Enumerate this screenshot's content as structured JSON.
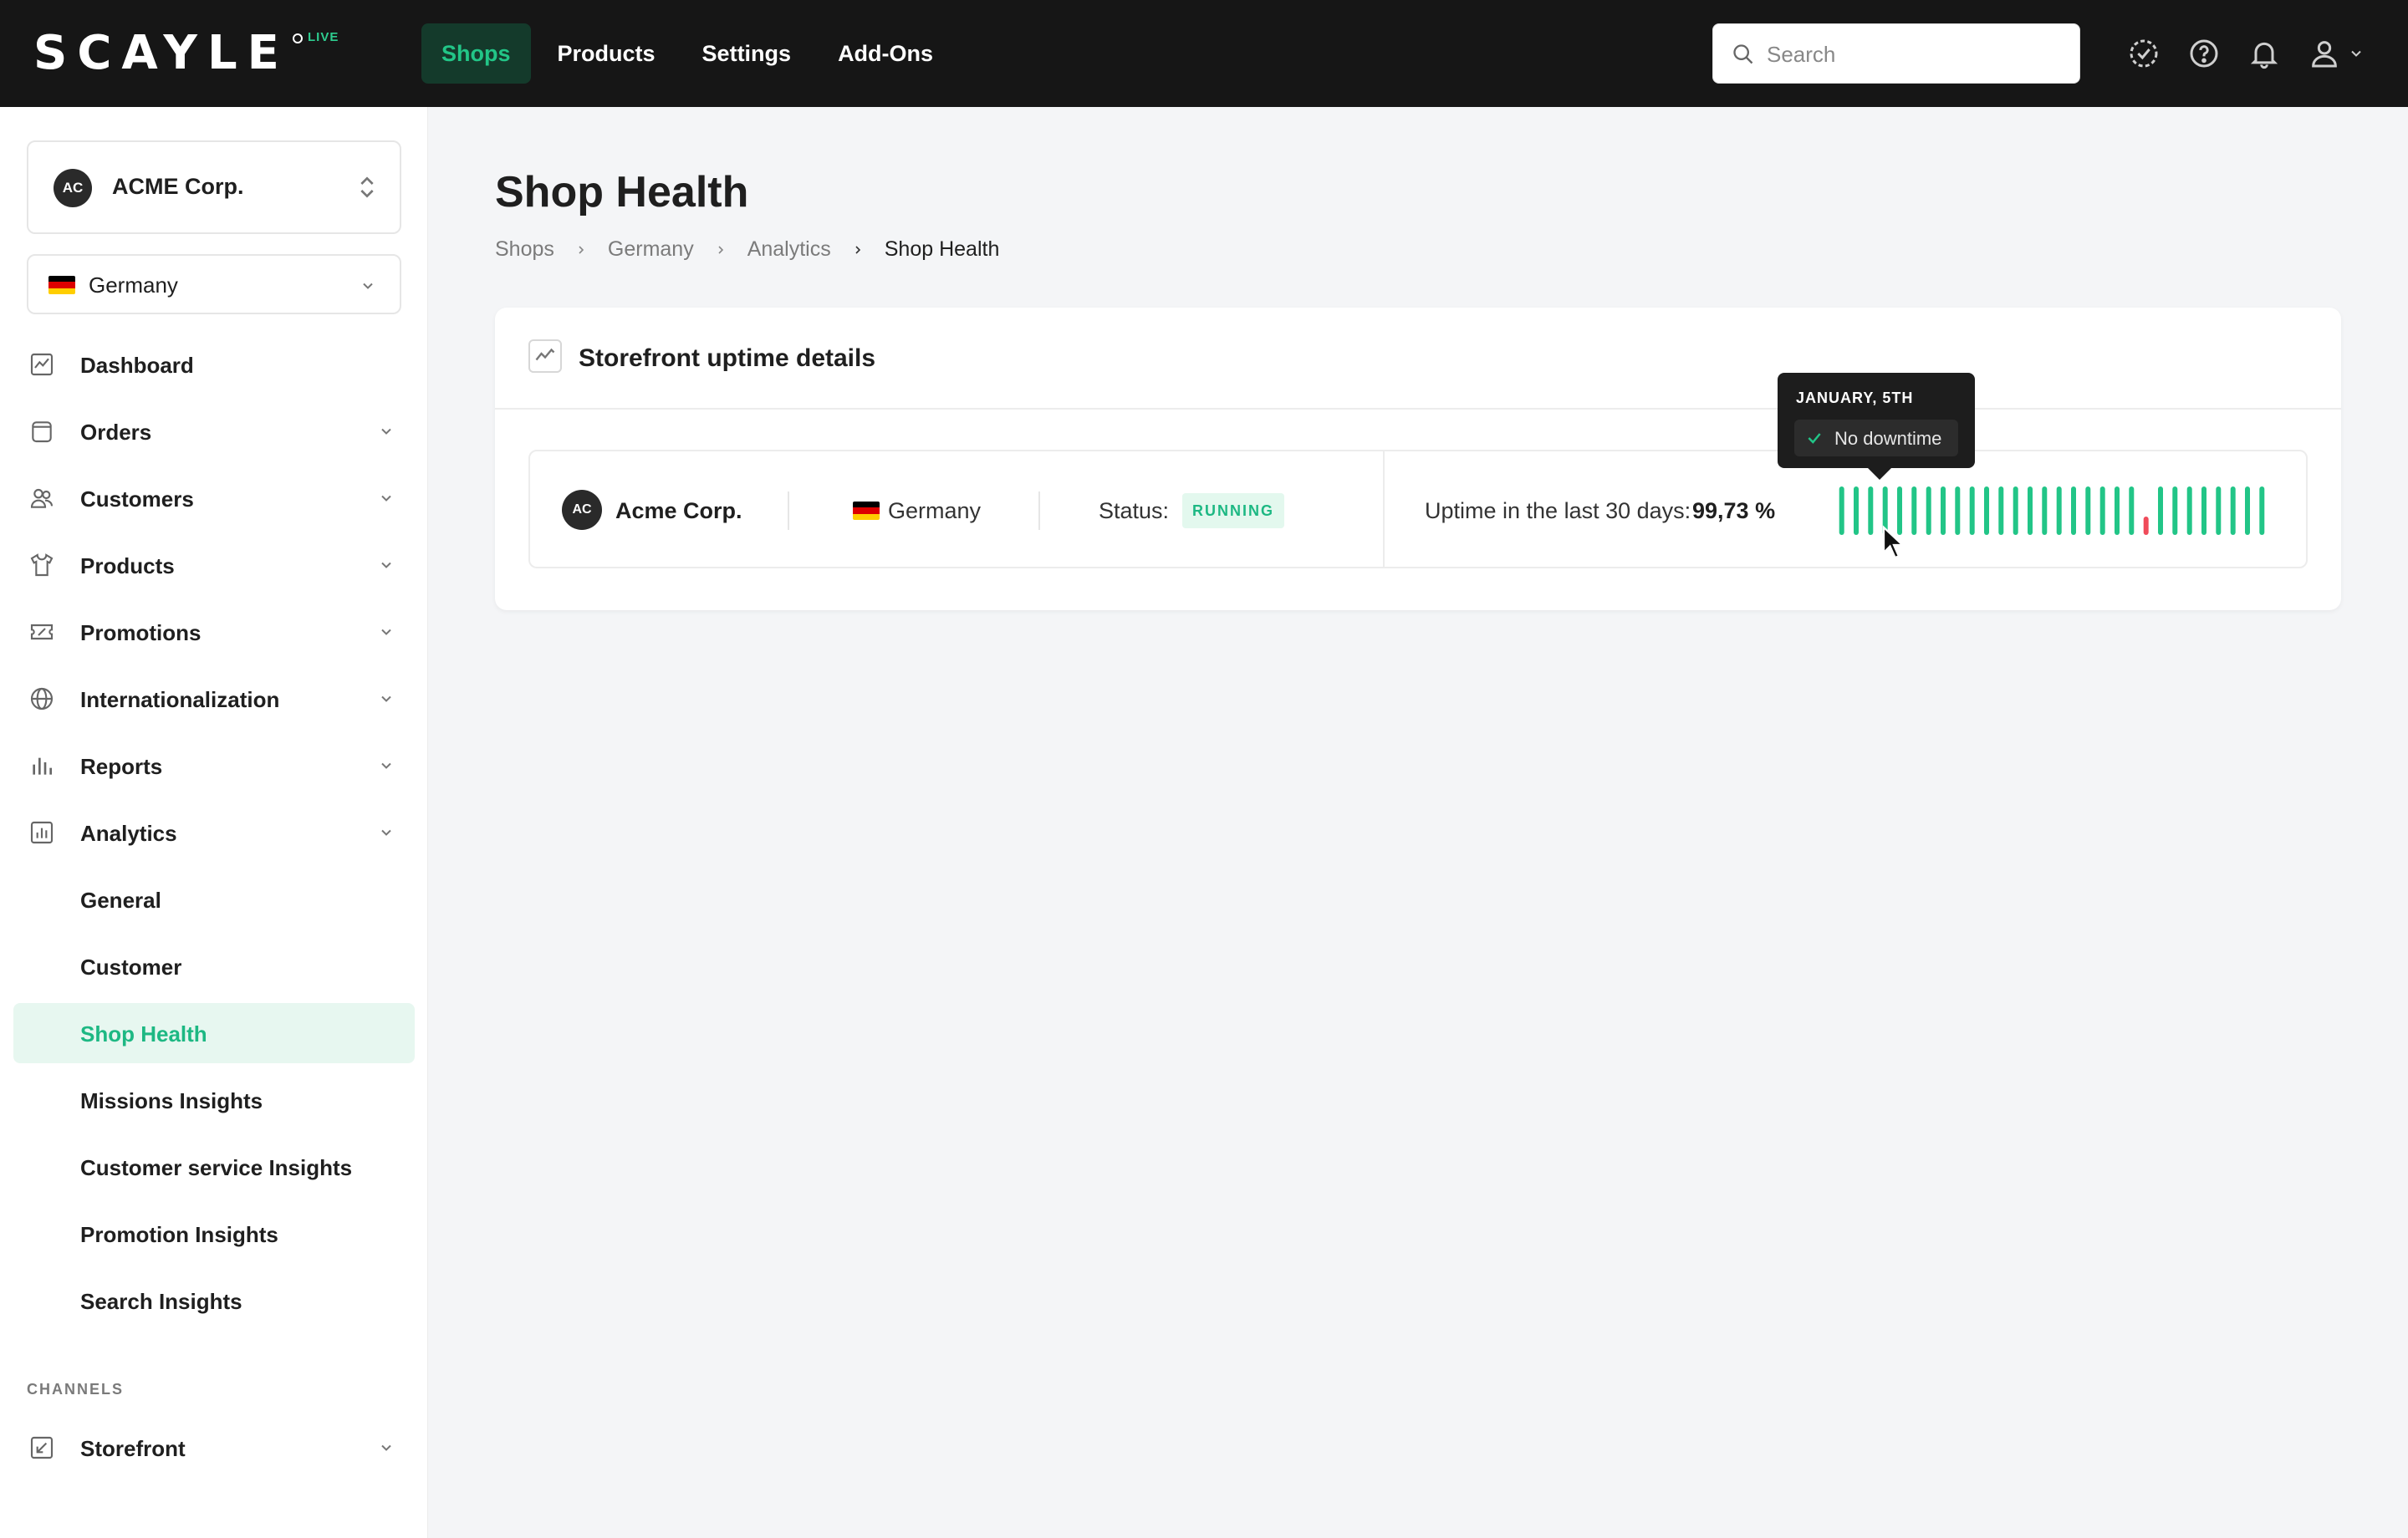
{
  "app": {
    "logo": "SCAYLE",
    "env_badge": "LIVE"
  },
  "topnav": {
    "items": [
      {
        "label": "Shops",
        "active": true
      },
      {
        "label": "Products",
        "active": false
      },
      {
        "label": "Settings",
        "active": false
      },
      {
        "label": "Add-Ons",
        "active": false
      }
    ],
    "search": {
      "placeholder": "Search",
      "value": ""
    },
    "icons": [
      "checklist-icon",
      "help-icon",
      "bell-icon",
      "user-icon",
      "chevron-down-icon"
    ]
  },
  "sidebar": {
    "org": {
      "initials": "AC",
      "name": "ACME Corp."
    },
    "country": {
      "name": "Germany"
    },
    "items": [
      {
        "label": "Dashboard",
        "icon": "dashboard-icon",
        "expandable": false
      },
      {
        "label": "Orders",
        "icon": "orders-icon",
        "expandable": true
      },
      {
        "label": "Customers",
        "icon": "customers-icon",
        "expandable": true
      },
      {
        "label": "Products",
        "icon": "tshirt-icon",
        "expandable": true
      },
      {
        "label": "Promotions",
        "icon": "ticket-icon",
        "expandable": true
      },
      {
        "label": "Internationalization",
        "icon": "globe-icon",
        "expandable": true
      },
      {
        "label": "Reports",
        "icon": "bar-chart-icon",
        "expandable": true
      },
      {
        "label": "Analytics",
        "icon": "analytics-icon",
        "expandable": true
      },
      {
        "label": "General",
        "sub": true
      },
      {
        "label": "Customer",
        "sub": true
      },
      {
        "label": "Shop Health",
        "sub": true,
        "active": true
      },
      {
        "label": "Missions Insights",
        "sub": true
      },
      {
        "label": "Customer service Insights",
        "sub": true
      },
      {
        "label": "Promotion Insights",
        "sub": true
      },
      {
        "label": "Search Insights",
        "sub": true
      }
    ],
    "section_channels": "CHANNELS",
    "storefront": {
      "label": "Storefront",
      "icon": "storefront-icon"
    }
  },
  "page": {
    "title": "Shop Health",
    "breadcrumb": [
      "Shops",
      "Germany",
      "Analytics",
      "Shop Health"
    ]
  },
  "card": {
    "title": "Storefront uptime details",
    "shop": {
      "initials": "AC",
      "name": "Acme Corp.",
      "country": "Germany",
      "status_label": "Status:",
      "status": "RUNNING",
      "uptime_label": "Uptime in the last 30 days:",
      "uptime_value": "99,73 %"
    }
  },
  "chart_data": {
    "type": "bar",
    "days": 30,
    "day_status": [
      "up",
      "up",
      "up",
      "up",
      "up",
      "up",
      "up",
      "up",
      "up",
      "up",
      "up",
      "up",
      "up",
      "up",
      "up",
      "up",
      "up",
      "up",
      "up",
      "up",
      "up",
      "down",
      "up",
      "up",
      "up",
      "up",
      "up",
      "up",
      "up",
      "up"
    ]
  },
  "tooltip": {
    "date": "JANUARY, 5TH",
    "text": "No downtime"
  },
  "colors": {
    "accent": "#1db883",
    "up": "#22c587",
    "down": "#f04b5a",
    "topbar": "#161616"
  }
}
